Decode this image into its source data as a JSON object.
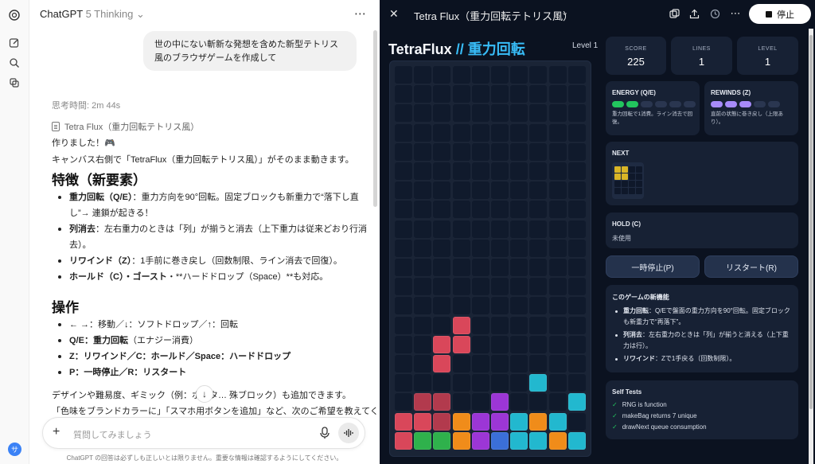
{
  "app": {
    "title": "ChatGPT",
    "model": "5 Thinking",
    "more": "⋯"
  },
  "rail": {
    "avatar_initial": "サ"
  },
  "chat": {
    "user_message": "世の中にない斬新な発想を含めた新型テトリス風のブラウザゲームを作成して",
    "thinking_time": "思考時間: 2m 44s",
    "doc_ref": "Tetra Flux（重力回転テトリス風）",
    "intro1": "作りました！🎮",
    "intro2": "キャンバス右側で「TetraFlux（重力回転テトリス風）」がそのまま動きます。",
    "features_heading": "特徴（新要素）",
    "features": [
      {
        "bold": "重力回転（Q/E）",
        "text": "：重力方向を90°回転。固定ブロックも新重力で“落下し直し”→ 連鎖が起きる！"
      },
      {
        "bold": "列消去",
        "text": "：左右重力のときは「列」が揃うと消去（上下重力は従来どおり行消去）。"
      },
      {
        "bold": "リワインド（Z）",
        "text": "：1手前に巻き戻し（回数制限、ライン消去で回復）。"
      },
      {
        "bold": "ホールド（C）・ゴースト",
        "text": "・**ハードドロップ（Space）**も対応。"
      }
    ],
    "controls_heading": "操作",
    "controls": [
      {
        "bold": "",
        "text": "← →：移動／↓：ソフトドロップ／↑：回転"
      },
      {
        "bold": "Q/E：重力回転",
        "text": "（エナジー消費）"
      },
      {
        "bold": "Z：リワインド／C：ホールド／Space：ハードドロップ",
        "text": ""
      },
      {
        "bold": "P：一時停止／R：リスタート",
        "text": ""
      }
    ],
    "outro1": "デザインや難易度、ギミック（例：ボータ… 殊ブロック）も追加できます。",
    "outro2": "「色味をブランドカラーに」「スマホ用ボタンを追加」など、次のご希望を教えてください！",
    "composer_placeholder": "質問してみましょう",
    "disclaimer": "ChatGPT の回答は必ずしも正しいとは限りません。重要な情報は確認するようにしてください。"
  },
  "canvas": {
    "title": "Tetra Flux（重力回転テトリス風）",
    "stop_label": "停止",
    "game_title_main": "TetraFlux",
    "game_title_sep": " // ",
    "game_title_sub": "重力回転",
    "level_label": "Level 1",
    "stats": [
      {
        "label": "SCORE",
        "value": "225"
      },
      {
        "label": "LINES",
        "value": "1"
      },
      {
        "label": "LEVEL",
        "value": "1"
      }
    ],
    "energy": {
      "label": "ENERGY (Q/E)",
      "filled": 2,
      "total": 6,
      "color": "#22c55e",
      "note": "重力回転で1消費。ライン消去で回復。"
    },
    "rewinds": {
      "label": "REWINDS (Z)",
      "filled": 3,
      "total": 5,
      "color": "#a78bfa",
      "note": "直前の状態に巻き戻し（上限あり）。"
    },
    "next_label": "NEXT",
    "hold_label": "HOLD (C)",
    "hold_value": "未使用",
    "pause_button": "一時停止(P)",
    "restart_button": "リスタート(R)",
    "features_card": {
      "title": "このゲームの新機能",
      "items": [
        {
          "bold": "重力回転",
          "text": "：Q/Eで盤面の重力方向を90°回転。固定ブロックも新重力で“再落下”。"
        },
        {
          "bold": "列消去",
          "text": "：左右重力のときは「列」が揃うと消える（上下重力は行）。"
        },
        {
          "bold": "リワインド",
          "text": "：Zで1手戻る（回数制限）。"
        }
      ]
    },
    "self_tests": {
      "title": "Self Tests",
      "items": [
        "RNG is function",
        "makeBag returns 7 unique",
        "drawNext queue consumption"
      ]
    }
  },
  "board_colors": {
    "R": "#d9475a",
    "D": "#b23a4d",
    "C": "#22b8cf",
    "O": "#f08c1a",
    "P": "#9c36d6",
    "G": "#2fb14c",
    "B": "#3b6fd8",
    "Y": "#d9b526"
  },
  "board": [
    "..........",
    "..........",
    "..........",
    "..........",
    "..........",
    "..........",
    "..........",
    "..........",
    "..........",
    "..........",
    "..........",
    "..........",
    "..........",
    "...R......",
    "..RR......",
    "..R.......",
    ".......C..",
    ".DD..P...C",
    "RRDOPPCOC.",
    "RGGOPBCCOC"
  ],
  "next_piece": [
    "YY..",
    "YY..",
    "....",
    "...."
  ]
}
